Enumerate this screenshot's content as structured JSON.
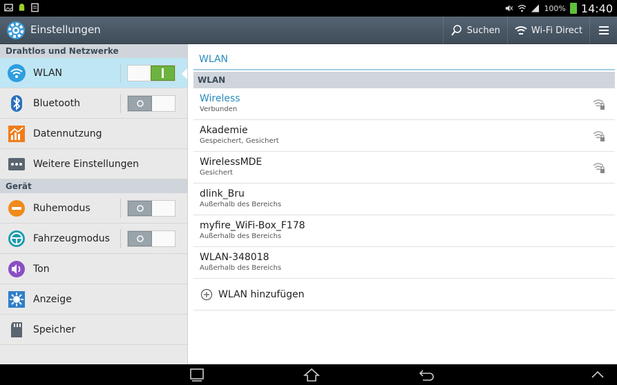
{
  "status_bar": {
    "battery_percent": "100%",
    "time": "14:40",
    "icons": [
      "gallery-icon",
      "android-icon",
      "notes-icon",
      "mute-icon",
      "wifi-icon",
      "signal-icon",
      "battery-icon"
    ]
  },
  "action_bar": {
    "title": "Einstellungen",
    "search_label": "Suchen",
    "wifi_direct_label": "Wi-Fi Direct"
  },
  "left_menu": {
    "section_wireless": "Drahtlos und Netzwerke",
    "wlan": {
      "label": "WLAN",
      "toggle": "on"
    },
    "bluetooth": {
      "label": "Bluetooth",
      "toggle": "off"
    },
    "data_usage": {
      "label": "Datennutzung"
    },
    "more_settings": {
      "label": "Weitere Einstellungen"
    },
    "section_device": "Gerät",
    "sleep_mode": {
      "label": "Ruhemodus",
      "toggle": "off"
    },
    "car_mode": {
      "label": "Fahrzeugmodus",
      "toggle": "off"
    },
    "sound": {
      "label": "Ton"
    },
    "display": {
      "label": "Anzeige"
    },
    "storage": {
      "label": "Speicher"
    }
  },
  "right_panel": {
    "title": "WLAN",
    "subheader": "WLAN",
    "networks": [
      {
        "name": "Wireless",
        "status": "Verbunden",
        "connected": true,
        "secured": true
      },
      {
        "name": "Akademie",
        "status": "Gespeichert, Gesichert",
        "connected": false,
        "secured": true
      },
      {
        "name": "WirelessMDE",
        "status": "Gesichert",
        "connected": false,
        "secured": true
      },
      {
        "name": "dlink_Bru",
        "status": "Außerhalb des Bereichs",
        "connected": false,
        "secured": false
      },
      {
        "name": "myfire_WiFi-Box_F178",
        "status": "Außerhalb des Bereichs",
        "connected": false,
        "secured": false
      },
      {
        "name": "WLAN-348018",
        "status": "Außerhalb des Bereichs",
        "connected": false,
        "secured": false
      }
    ],
    "add_network_label": "WLAN hinzufügen"
  },
  "colors": {
    "accent": "#2a8cc0",
    "selected_row": "#bfe6f5",
    "toggle_on": "#6db33f",
    "section_header": "#cfd5db",
    "action_bar": "#4a5866"
  }
}
